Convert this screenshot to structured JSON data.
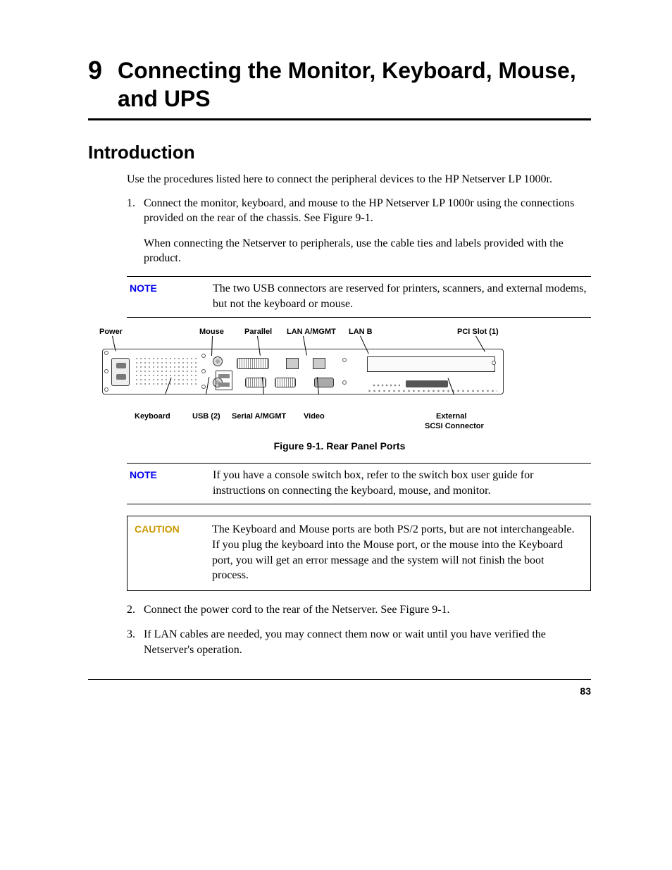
{
  "chapter": {
    "number": "9",
    "title": "Connecting the Monitor, Keyboard, Mouse, and UPS"
  },
  "section_heading": "Introduction",
  "intro_para": "Use the procedures listed here to connect the peripheral devices to the HP Netserver LP 1000r.",
  "steps": {
    "s1_num": "1.",
    "s1_p1": "Connect the monitor, keyboard, and mouse to the HP Netserver LP 1000r using the connections provided on the rear of the chassis. See Figure 9-1.",
    "s1_p2": "When connecting the Netserver to peripherals, use the cable ties and labels provided with the product.",
    "s2_num": "2.",
    "s2_p1": "Connect the power cord to the rear of the Netserver. See Figure 9-1.",
    "s3_num": "3.",
    "s3_p1": "If LAN cables are needed, you may connect them now or wait until you have verified the Netserver's operation."
  },
  "note1": {
    "label": "NOTE",
    "text": "The two USB connectors are reserved for printers, scanners, and external modems, but not the keyboard or mouse."
  },
  "note2": {
    "label": "NOTE",
    "text": "If you have a console switch box, refer to the switch box user guide for instructions on connecting the keyboard, mouse, and monitor."
  },
  "caution": {
    "label": "CAUTION",
    "text": "The Keyboard and Mouse ports are both PS/2 ports, but are not interchangeable. If you plug the keyboard into the Mouse port, or the mouse into the Keyboard port, you will get an error message and the system will not finish the boot process."
  },
  "diagram": {
    "top_labels": {
      "power": "Power",
      "mouse": "Mouse",
      "parallel": "Parallel",
      "lan_a": "LAN A/MGMT",
      "lan_b": "LAN B",
      "pci": "PCI Slot (1)"
    },
    "bottom_labels": {
      "keyboard": "Keyboard",
      "usb": "USB (2)",
      "serial": "Serial A/MGMT",
      "video": "Video",
      "scsi_l1": "External",
      "scsi_l2": "SCSI Connector"
    },
    "caption": "Figure 9-1. Rear Panel Ports"
  },
  "page_number": "83"
}
